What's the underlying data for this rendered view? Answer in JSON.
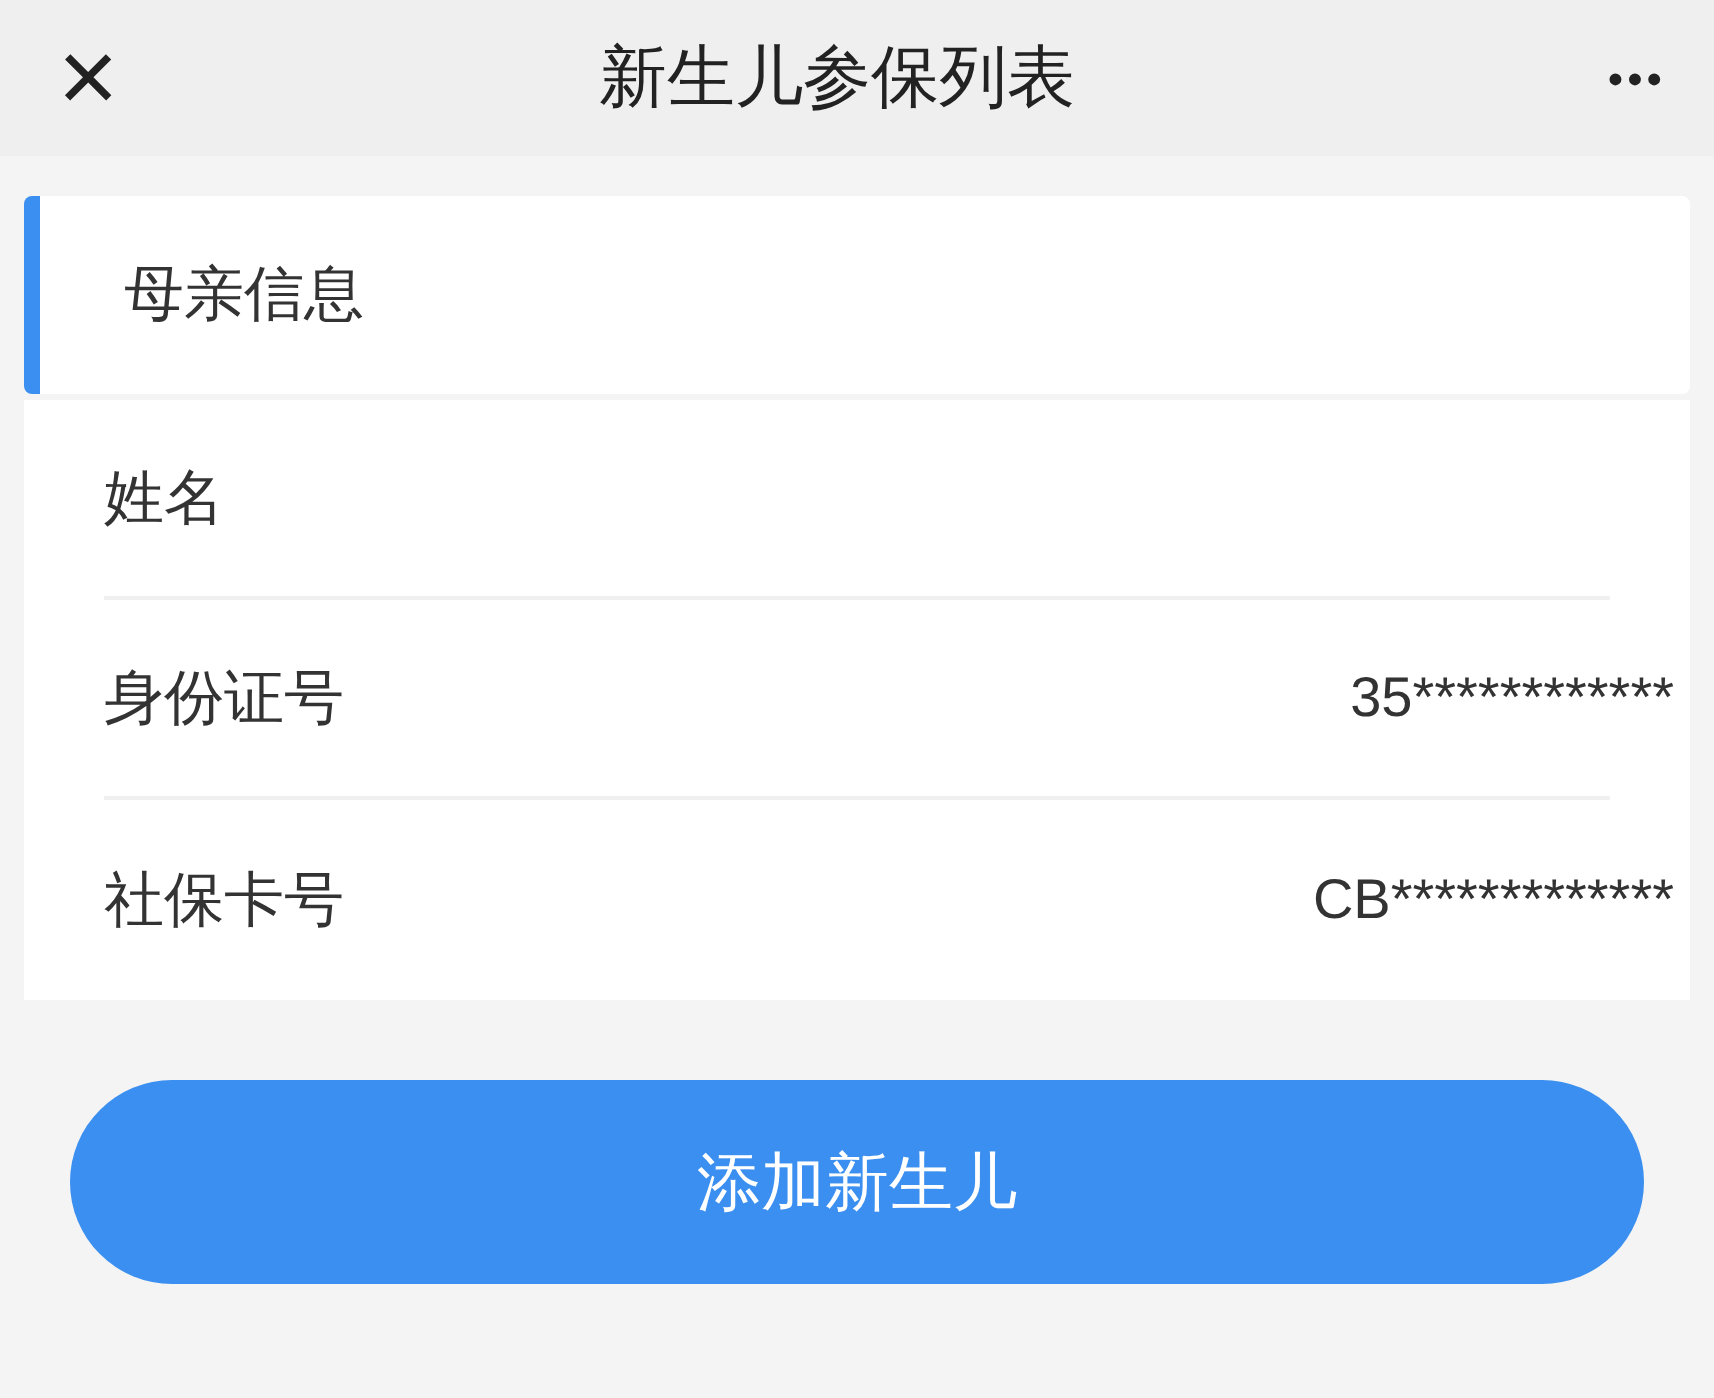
{
  "header": {
    "close": "×",
    "title": "新生儿参保列表",
    "more": "•••"
  },
  "section": {
    "title": "母亲信息"
  },
  "fields": [
    {
      "label": "姓名"
    },
    {
      "label": "身份证号",
      "value": "35************"
    },
    {
      "label": "社保卡号",
      "value": "CB*************"
    }
  ],
  "button": "添加新生儿"
}
